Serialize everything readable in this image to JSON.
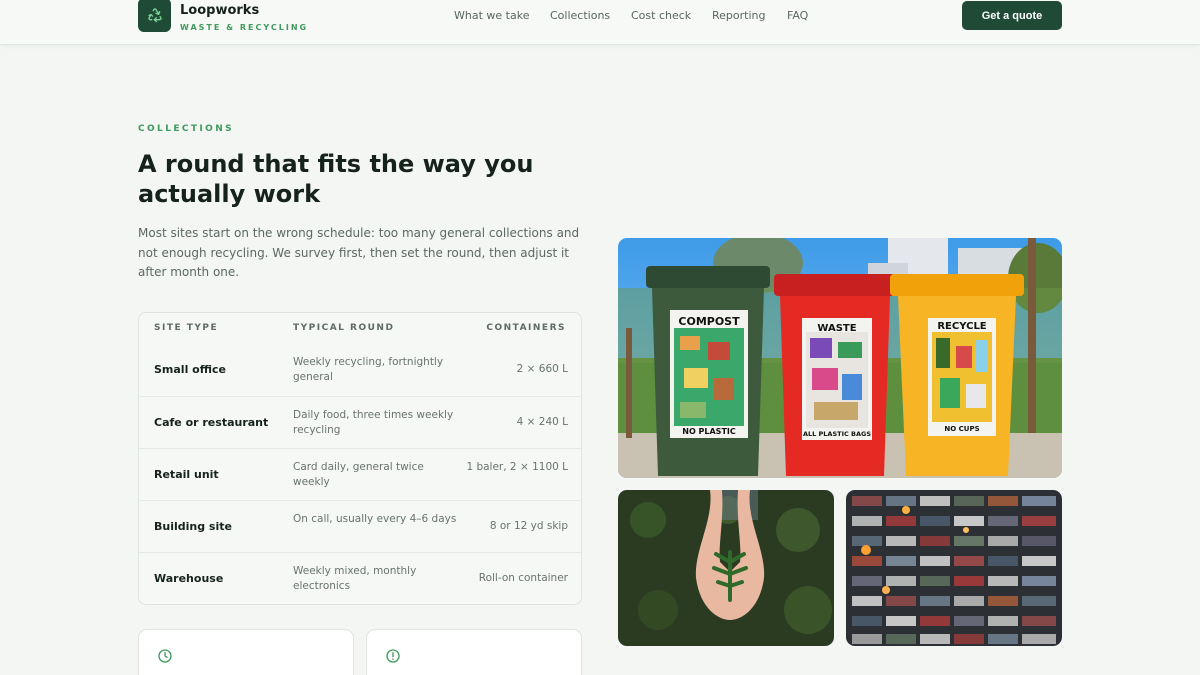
{
  "brand": {
    "name": "Loopworks",
    "tagline": "WASTE & RECYCLING",
    "logo_icon": "recycle-icon"
  },
  "nav": {
    "items": [
      {
        "label": "What we take"
      },
      {
        "label": "Collections"
      },
      {
        "label": "Cost check"
      },
      {
        "label": "Reporting"
      },
      {
        "label": "FAQ"
      }
    ],
    "cta_label": "Get a quote"
  },
  "intro": {
    "eyebrow": "COLLECTIONS",
    "headline": "A round that fits the way you actually work",
    "lede": "Most sites start on the wrong schedule: too many general collections and not enough recycling. We survey first, then set the round, then adjust it after month one."
  },
  "table": {
    "headers": {
      "site_type": "SITE TYPE",
      "round": "TYPICAL ROUND",
      "containers": "CONTAINERS"
    },
    "rows": [
      {
        "site_type": "Small office",
        "round": "Weekly recycling, fortnightly general",
        "containers": "2 × 660 L"
      },
      {
        "site_type": "Cafe or restaurant",
        "round": "Daily food, three times weekly recycling",
        "containers": "4 × 240 L"
      },
      {
        "site_type": "Retail unit",
        "round": "Card daily, general twice weekly",
        "containers": "1 baler, 2 × 1100 L"
      },
      {
        "site_type": "Building site",
        "round": "On call, usually every 4–6 days",
        "containers": "8 or 12 yd skip"
      },
      {
        "site_type": "Warehouse",
        "round": "Weekly mixed, monthly electronics",
        "containers": "Roll-on container"
      }
    ]
  },
  "cards": [
    {
      "icon": "clock-icon"
    },
    {
      "icon": "alert-circle-icon"
    }
  ],
  "photos": {
    "bins": {
      "labels": [
        "COMPOST",
        "WASTE",
        "RECYCLE"
      ],
      "footers": [
        "NO PLASTIC",
        "ALL PLASTIC BAGS",
        "NO CUPS"
      ]
    }
  },
  "colors": {
    "accent_dark": "#1f4a36",
    "accent_green": "#3f9a5d",
    "background": "#f3f6f3"
  }
}
